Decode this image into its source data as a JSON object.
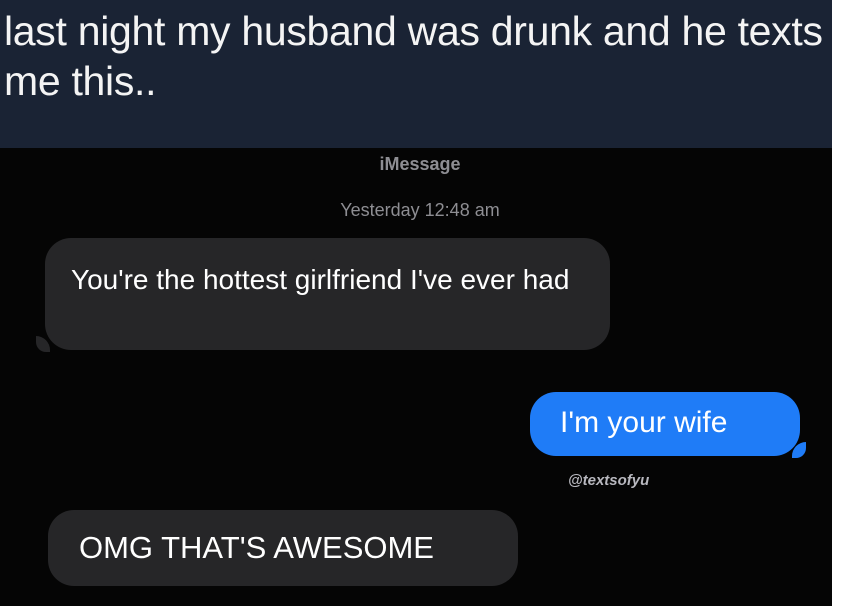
{
  "caption": {
    "text": "last night my husband was drunk and he texts me this.."
  },
  "conversation": {
    "service_label": "iMessage",
    "timestamp": "Yesterday 12:48 am",
    "messages": [
      {
        "direction": "received",
        "text": "You're the hottest girlfriend I've ever had"
      },
      {
        "direction": "sent",
        "text": "I'm your wife"
      },
      {
        "direction": "received",
        "text": "OMG THAT'S AWESOME"
      }
    ],
    "watermark": "@textsofyu"
  },
  "colors": {
    "caption_background": "#1a2334",
    "chat_background": "#050505",
    "received_bubble": "#262628",
    "sent_bubble": "#1f7cf7",
    "meta_text": "#8e8e93"
  }
}
